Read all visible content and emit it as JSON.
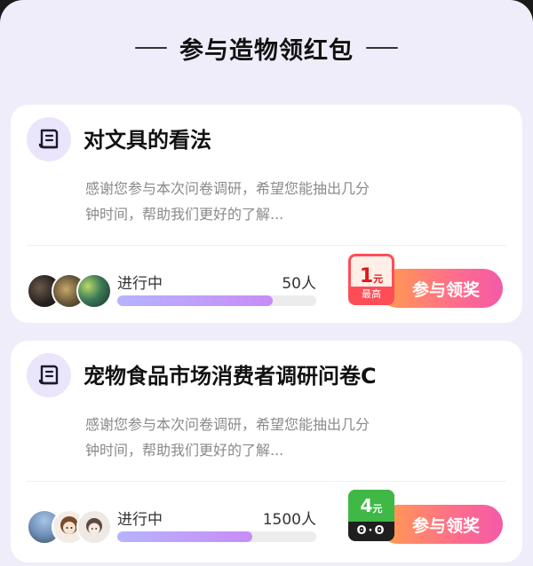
{
  "header": {
    "title": "参与造物领红包"
  },
  "surveys": [
    {
      "title": "对文具的看法",
      "description": "感谢您参与本次问卷调研，希望您能抽出几分钟时间，帮助我们更好的了解...",
      "status": "进行中",
      "participants": "50人",
      "progress": 0.78,
      "reward_amount": "1",
      "reward_unit": "元",
      "reward_tag": "最高",
      "cta_label": "参与领奖"
    },
    {
      "title": "宠物食品市场消费者调研问卷C",
      "description": "感谢您参与本次问卷调研，希望您能抽出几分钟时间，帮助我们更好的了解...",
      "status": "进行中",
      "participants": "1500人",
      "progress": 0.68,
      "reward_amount": "4",
      "reward_unit": "元",
      "reward_face": "ʘ·ʘ",
      "cta_label": "参与领奖"
    }
  ],
  "colors": {
    "accent_gradient_start": "#ff9f4a",
    "accent_gradient_end": "#f45aa8",
    "progress_fill": "#c88cf5",
    "badge_red": "#ff4d58",
    "badge_green": "#3fb846"
  }
}
